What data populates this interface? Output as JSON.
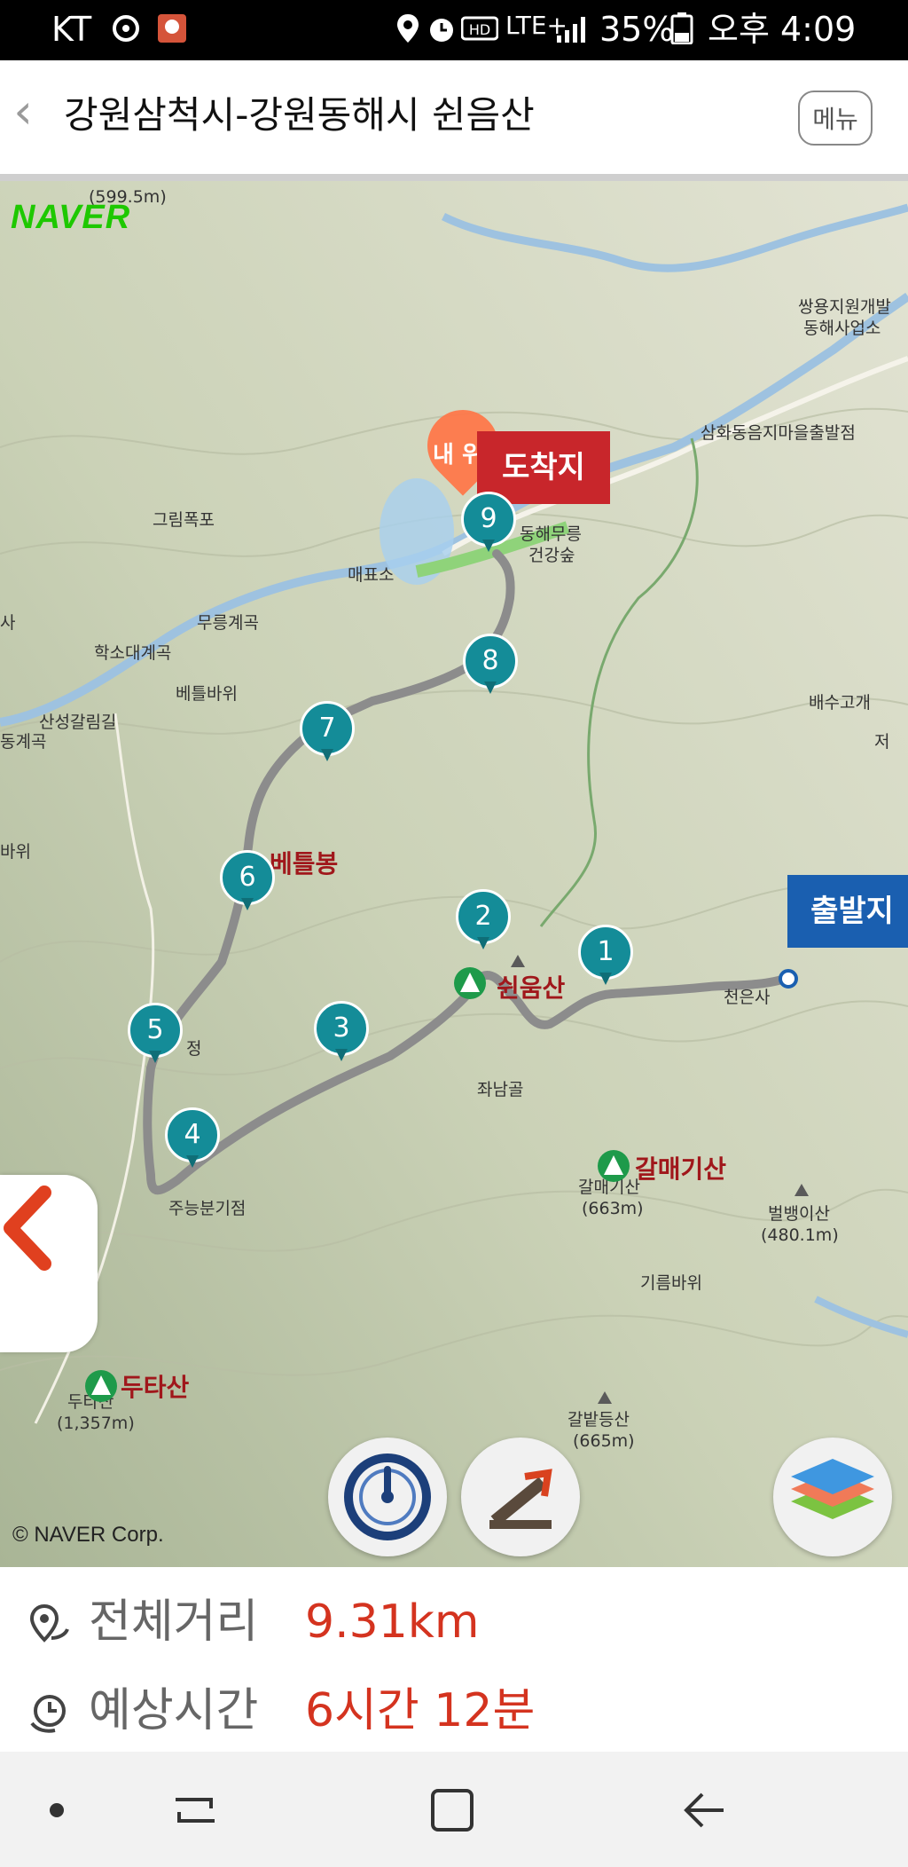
{
  "status_bar": {
    "carrier": "KT",
    "network": "LTE+",
    "battery": "35%",
    "time": "오후 4:09"
  },
  "header": {
    "title": "강원삼척시-강원동해시 쉰음산",
    "menu_label": "메뉴"
  },
  "map": {
    "provider_logo": "NAVER",
    "copyright": "© NAVER Corp.",
    "my_position_label": "내 위치",
    "end_flag_label": "도착지",
    "start_flag_label": "출발지",
    "waypoints": [
      "1",
      "2",
      "3",
      "4",
      "5",
      "6",
      "7",
      "8",
      "9"
    ],
    "peaks": {
      "main": "쉰움산",
      "betulbong": "베틀봉",
      "dutasan": "두타산",
      "galmae": "갈매기산"
    },
    "labels": {
      "top_elev": "(599.5m)",
      "ssangyong": "쌍용지원개발",
      "ssangyong2": "동해사업소",
      "samhwa": "삼화동음지마을출발점",
      "donghae_forest1": "동해무릉",
      "donghae_forest2": "건강숲",
      "grimpokpo": "그림폭포",
      "maepyoso": "매표소",
      "mureung_valley": "무릉계곡",
      "hakso_valley": "학소대계곡",
      "betul_rock": "베틀바위",
      "sanseong": "산성갈림길",
      "baesu": "배수고개",
      "jwanam": "좌남골",
      "galmae_elev1": "갈매기산",
      "galmae_elev2": "(663m)",
      "byeolbaeng1": "벌뱅이산",
      "byeolbaeng2": "(480.1m)",
      "gireum": "기름바위",
      "galbat1": "갈밭등산",
      "galbat2": "(665m)",
      "dutasan_sub1": "두타산",
      "dutasan_sub2": "(1,357m)",
      "jooneung": "주능분기점",
      "sa": "사",
      "gyegok": "동계곡",
      "jeo": "저",
      "wi": "바위",
      "jeong": "정",
      "cheoneun": "천은사"
    },
    "route_color": "#8c8c8c",
    "marker_color": "#148c98"
  },
  "info": {
    "distance_label": "전체거리",
    "distance_value": "9.31km",
    "time_label": "예상시간",
    "time_value": "6시간 12분"
  },
  "icons": {
    "back": "chevron-left-icon",
    "distance": "location-route-icon",
    "time": "clock-icon",
    "speed": "speedometer-icon",
    "slope": "slope-icon",
    "layers": "layers-icon"
  }
}
